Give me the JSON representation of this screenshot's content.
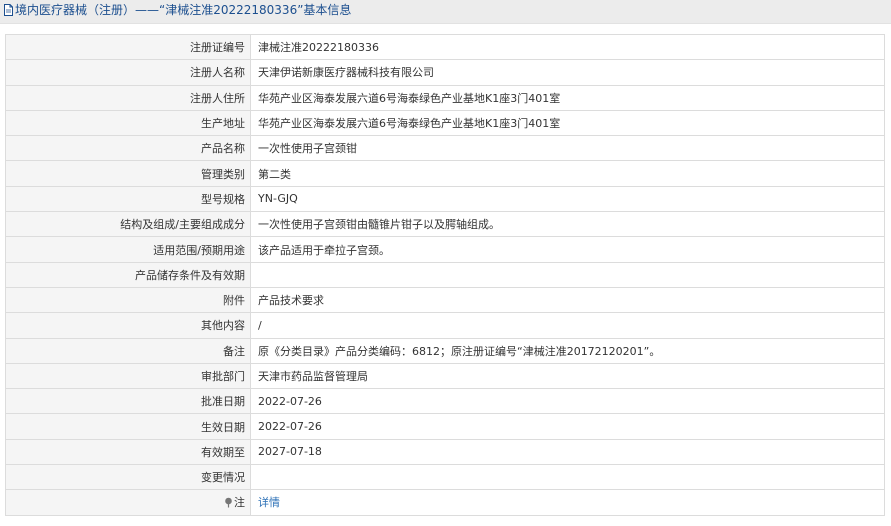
{
  "header": {
    "title": "境内医疗器械（注册）——“津械注准20222180336”基本信息",
    "icon": "document-icon"
  },
  "colors": {
    "header_bg": "#ececec",
    "title_text": "#1c4f8f",
    "label_bg": "#f5f5f5",
    "border": "#dcdcdc",
    "link": "#2a6fb6"
  },
  "rows": [
    {
      "name": "registration-number",
      "label": "注册证编号",
      "value": "津械注准20222180336"
    },
    {
      "name": "registrant-name",
      "label": "注册人名称",
      "value": "天津伊诺新康医疗器械科技有限公司"
    },
    {
      "name": "registrant-address",
      "label": "注册人住所",
      "value": "华苑产业区海泰发展六道6号海泰绿色产业基地K1座3门401室"
    },
    {
      "name": "production-address",
      "label": "生产地址",
      "value": "华苑产业区海泰发展六道6号海泰绿色产业基地K1座3门401室"
    },
    {
      "name": "product-name",
      "label": "产品名称",
      "value": "一次性使用子宫颈钳"
    },
    {
      "name": "management-category",
      "label": "管理类别",
      "value": "第二类"
    },
    {
      "name": "model-spec",
      "label": "型号规格",
      "value": "YN-GJQ"
    },
    {
      "name": "structure-composition",
      "label": "结构及组成/主要组成成分",
      "value": "一次性使用子宫颈钳由髓锥片钳子以及腭轴组成。"
    },
    {
      "name": "intended-use",
      "label": "适用范围/预期用途",
      "value": "该产品适用于牵拉子宫颈。"
    },
    {
      "name": "storage-validity",
      "label": "产品储存条件及有效期",
      "value": ""
    },
    {
      "name": "attachment",
      "label": "附件",
      "value": "产品技术要求"
    },
    {
      "name": "other-content",
      "label": "其他内容",
      "value": "/"
    },
    {
      "name": "remarks",
      "label": "备注",
      "value": "原《分类目录》产品分类编码：6812；原注册证编号“津械注准20172120201”。"
    },
    {
      "name": "approval-department",
      "label": "审批部门",
      "value": "天津市药品监督管理局"
    },
    {
      "name": "approval-date",
      "label": "批准日期",
      "value": "2022-07-26"
    },
    {
      "name": "effective-date",
      "label": "生效日期",
      "value": "2022-07-26"
    },
    {
      "name": "expiry-date",
      "label": "有效期至",
      "value": "2027-07-18"
    },
    {
      "name": "change-status",
      "label": "变更情况",
      "value": ""
    }
  ],
  "note_row": {
    "label": "注",
    "icon": "pin-icon",
    "link_text": "详情"
  }
}
